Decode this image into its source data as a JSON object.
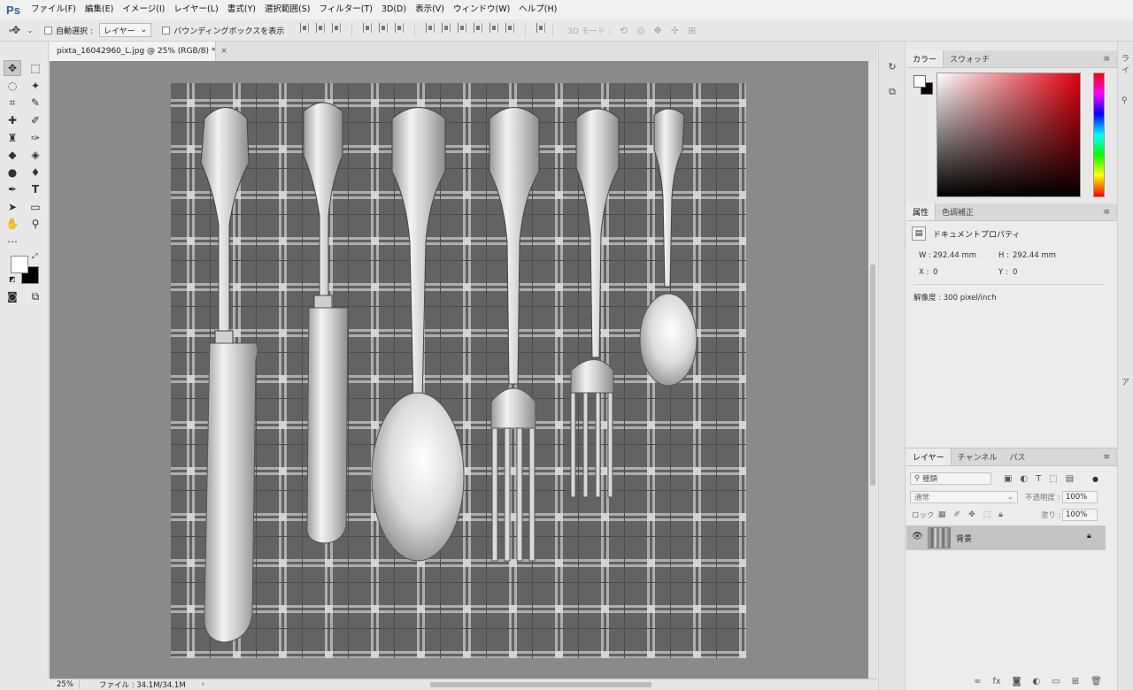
{
  "app": {
    "logo": "Ps"
  },
  "menu": [
    "ファイル(F)",
    "編集(E)",
    "イメージ(I)",
    "レイヤー(L)",
    "書式(Y)",
    "選択範囲(S)",
    "フィルター(T)",
    "3D(D)",
    "表示(V)",
    "ウィンドウ(W)",
    "ヘルプ(H)"
  ],
  "options": {
    "auto_select_label": "自動選択 :",
    "auto_select_value": "レイヤー",
    "bounding_box_label": "バウンディングボックスを表示",
    "mode3d_label": "3D モード :"
  },
  "document": {
    "tab_title": "pixta_16042960_L.jpg @ 25% (RGB/8) *",
    "close": "×"
  },
  "status": {
    "zoom": "25%",
    "file_info": "ファイル : 34.1M/34.1M",
    "arrow": "›"
  },
  "panels": {
    "color": {
      "tabs": [
        "カラー",
        "スウォッチ"
      ],
      "menu": "≡"
    },
    "properties": {
      "tabs": [
        "属性",
        "色調補正"
      ],
      "title": "ドキュメントプロパティ",
      "w_label": "W :",
      "w_value": "292.44 mm",
      "h_label": "H :",
      "h_value": "292.44 mm",
      "x_label": "X :",
      "x_value": "0",
      "y_label": "Y :",
      "y_value": "0",
      "resolution": "解像度 : 300 pixel/inch"
    },
    "layers": {
      "tabs": [
        "レイヤー",
        "チャンネル",
        "パス"
      ],
      "filter_placeholder": "種類",
      "blend_mode": "通常",
      "opacity_label": "不透明度 :",
      "opacity_value": "100%",
      "lock_label": "ロック :",
      "fill_label": "塗り :",
      "fill_value": "100%",
      "layer_name": "背景"
    }
  },
  "far_right": {
    "label_top": "ライ",
    "label_mid": "ア"
  }
}
